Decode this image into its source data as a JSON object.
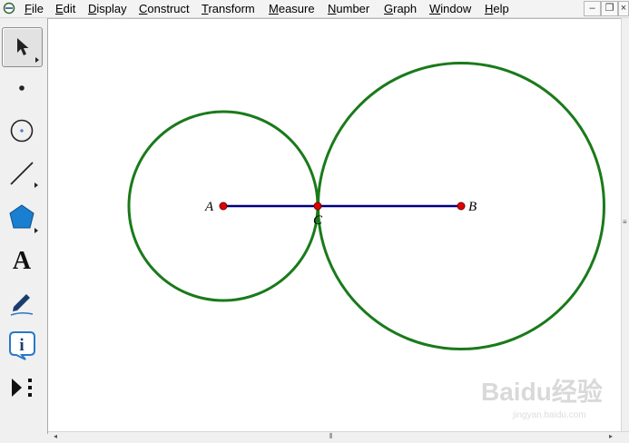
{
  "menubar": {
    "items": [
      {
        "name": "menu-file",
        "label": "File",
        "underline": "F",
        "rest": "ile"
      },
      {
        "name": "menu-edit",
        "label": "Edit",
        "underline": "E",
        "rest": "dit"
      },
      {
        "name": "menu-display",
        "label": "Display",
        "underline": "D",
        "rest": "isplay"
      },
      {
        "name": "menu-construct",
        "label": "Construct",
        "underline": "C",
        "rest": "onstruct"
      },
      {
        "name": "menu-transform",
        "label": "Transform",
        "underline": "T",
        "rest": "ransform"
      },
      {
        "name": "menu-measure",
        "label": "Measure",
        "underline": "M",
        "rest": "easure"
      },
      {
        "name": "menu-number",
        "label": "Number",
        "underline": "N",
        "rest": "umber"
      },
      {
        "name": "menu-graph",
        "label": "Graph",
        "underline": "G",
        "rest": "raph"
      },
      {
        "name": "menu-window",
        "label": "Window",
        "underline": "W",
        "rest": "indow"
      },
      {
        "name": "menu-help",
        "label": "Help",
        "underline": "H",
        "rest": "elp"
      }
    ],
    "window_buttons": {
      "minimize": "–",
      "restore": "❐",
      "close": "×"
    }
  },
  "toolbar": {
    "tools": [
      {
        "name": "arrow-tool",
        "icon": "arrow-icon",
        "selected": true
      },
      {
        "name": "point-tool",
        "icon": "point-icon"
      },
      {
        "name": "compass-tool",
        "icon": "compass-icon"
      },
      {
        "name": "straightedge-tool",
        "icon": "straightedge-icon"
      },
      {
        "name": "polygon-tool",
        "icon": "polygon-icon"
      },
      {
        "name": "text-tool",
        "icon": "text-icon",
        "label": "A"
      },
      {
        "name": "marker-tool",
        "icon": "marker-icon"
      },
      {
        "name": "information-tool",
        "icon": "information-icon",
        "label": "i"
      },
      {
        "name": "custom-tool",
        "icon": "custom-tool-icon"
      }
    ]
  },
  "canvas": {
    "points": [
      {
        "name": "point-a",
        "label": "A"
      },
      {
        "name": "point-b",
        "label": "B"
      },
      {
        "name": "point-c",
        "label": "C"
      }
    ],
    "colors": {
      "circle": "#1a7a1a",
      "segment": "#000080",
      "point": "#e00000"
    }
  },
  "watermark": {
    "text": "Baidu经验",
    "sub": "jingyan.baidu.com"
  }
}
